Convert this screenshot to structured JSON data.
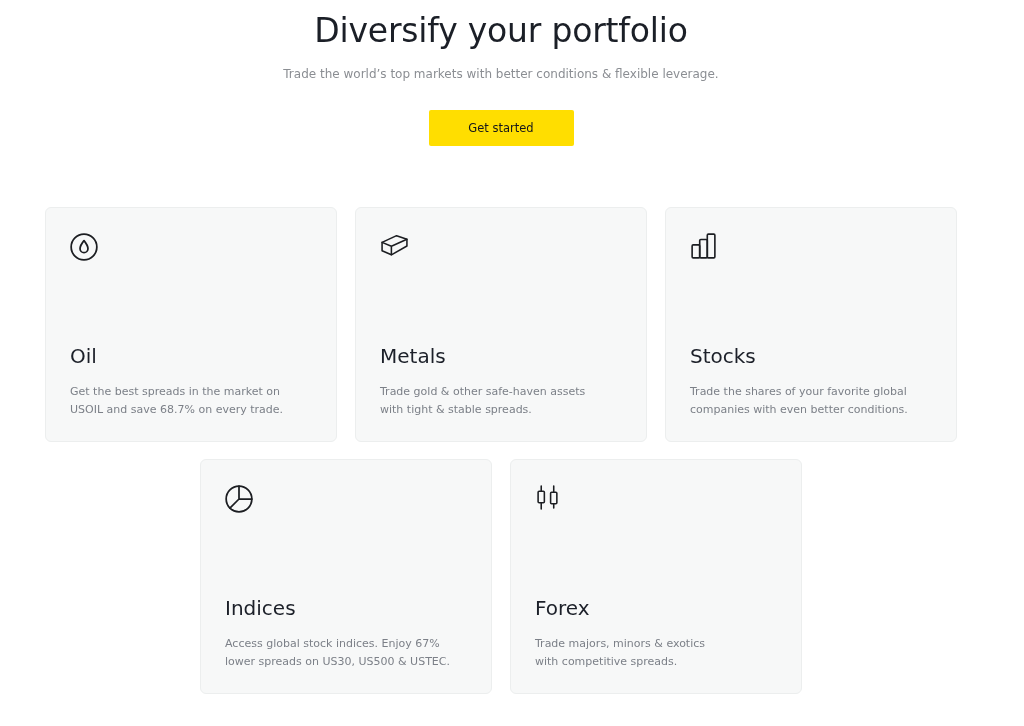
{
  "hero": {
    "title": "Diversify your portfolio",
    "subtitle": "Trade the world’s top markets with better conditions & flexible leverage.",
    "button": "Get started"
  },
  "markets": [
    {
      "title": "Oil",
      "description": "Get the best spreads in the market on\nUSOIL and save 68.7% on every trade."
    },
    {
      "title": "Metals",
      "description": "Trade gold & other safe-haven assets\nwith tight & stable spreads."
    },
    {
      "title": "Stocks",
      "description": "Trade the shares of your favorite global\ncompanies with even better conditions."
    },
    {
      "title": "Indices",
      "description": "Access global stock indices. Enjoy 67%\nlower spreads on US30, US500 & USTEC."
    },
    {
      "title": "Forex",
      "description": "Trade majors, minors & exotics\nwith competitive spreads."
    }
  ]
}
